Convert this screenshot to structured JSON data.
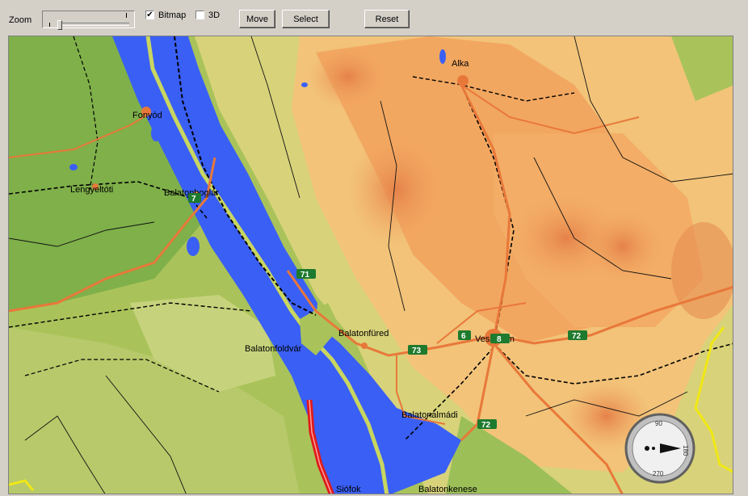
{
  "toolbar": {
    "zoom_label": "Zoom",
    "bitmap_label": "Bitmap",
    "bitmap_checked": true,
    "threed_label": "3D",
    "threed_checked": false,
    "move_label": "Move",
    "select_label": "Select",
    "reset_label": "Reset"
  },
  "map": {
    "places": [
      "Alka",
      "Fonyód",
      "Lengyeltóti",
      "Balatonboglár",
      "Balatonfüred",
      "Balatonfoldvár",
      "Balatonalmádi",
      "Balatonkenese",
      "Siófok",
      "Veszprém"
    ],
    "road_shields": [
      "7",
      "71",
      "73",
      "8",
      "72",
      "6",
      "72"
    ],
    "compass": {
      "n": "90",
      "e": "180",
      "s": "270"
    }
  },
  "colors": {
    "water": "#3a5ff4",
    "low_land": "#a9c35a",
    "highland": "#f2a760",
    "road": "#e8783a",
    "motorway": "#e01a1a",
    "border": "#f0e814",
    "shield": "#1e7a2e"
  }
}
